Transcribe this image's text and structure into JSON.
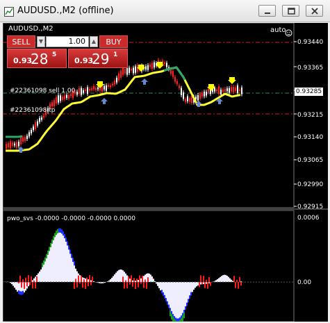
{
  "window": {
    "title": "AUDUSD.,M2 (offline)",
    "controls": [
      "minimize",
      "restore",
      "close"
    ]
  },
  "chart": {
    "symbol_label": "AUDUSD.,M2",
    "mode_label": "auto",
    "trade_panel": {
      "sell_label": "SELL",
      "buy_label": "BUY",
      "lot_value": "1.00",
      "bid": {
        "prefix": "0.93",
        "big": "28",
        "sup": "5"
      },
      "ask": {
        "prefix": "0.93",
        "big": "29",
        "sup": "1"
      }
    },
    "price_axis": [
      "0.93440",
      "0.93365",
      "0.93285",
      "0.93215",
      "0.93140",
      "0.93065",
      "0.92990",
      "0.92915"
    ],
    "current_price": "0.93285",
    "orders": [
      {
        "label": "#22361098 sell 1.00"
      },
      {
        "label": "#22361098 tp"
      }
    ],
    "colors": {
      "background": "#000000",
      "bull_candle": "#ffffff",
      "bear_candle": "#ff2020",
      "ma_line": "#ffff33",
      "trend_up": "#2ea86a",
      "signal_arrow_down": "#ffff00",
      "signal_arrow_up": "#6688cc",
      "order_line": "#2e8b57",
      "tp_line": "#cc2020"
    }
  },
  "indicator": {
    "label": "pwo_svs -0.0000 -0.0000 -0.0000 0.0000",
    "axis": [
      "0.0006",
      "0.00"
    ],
    "colors": {
      "main": "#eeeeff",
      "green": "#1aa01a",
      "blue": "#1a30ff",
      "red": "#ff1a1a"
    }
  }
}
